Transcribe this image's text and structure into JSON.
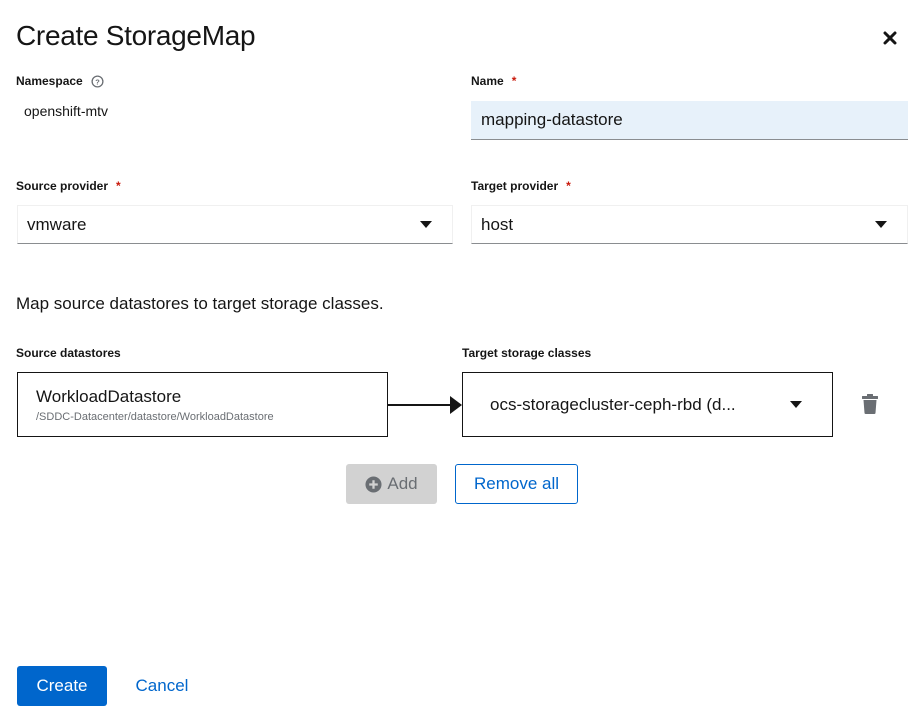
{
  "dialog": {
    "title": "Create StorageMap"
  },
  "namespace": {
    "label": "Namespace",
    "value": "openshift-mtv"
  },
  "name": {
    "label": "Name",
    "required_mark": "*",
    "value": "mapping-datastore"
  },
  "source_provider": {
    "label": "Source provider",
    "required_mark": "*",
    "selected": "vmware"
  },
  "target_provider": {
    "label": "Target provider",
    "required_mark": "*",
    "selected": "host"
  },
  "mapping": {
    "description": "Map source datastores to target storage classes.",
    "source_header": "Source datastores",
    "target_header": "Target storage classes",
    "rows": [
      {
        "source_name": "WorkloadDatastore",
        "source_path": "/SDDC-Datacenter/datastore/WorkloadDatastore",
        "target": "ocs-storagecluster-ceph-rbd (d..."
      }
    ],
    "add_label": "Add",
    "remove_all_label": "Remove all"
  },
  "footer": {
    "create_label": "Create",
    "cancel_label": "Cancel"
  },
  "colors": {
    "primary": "#0066cc",
    "required": "#c9190b",
    "input_bg": "#e7f1fa",
    "disabled_bg": "#d2d2d2"
  }
}
